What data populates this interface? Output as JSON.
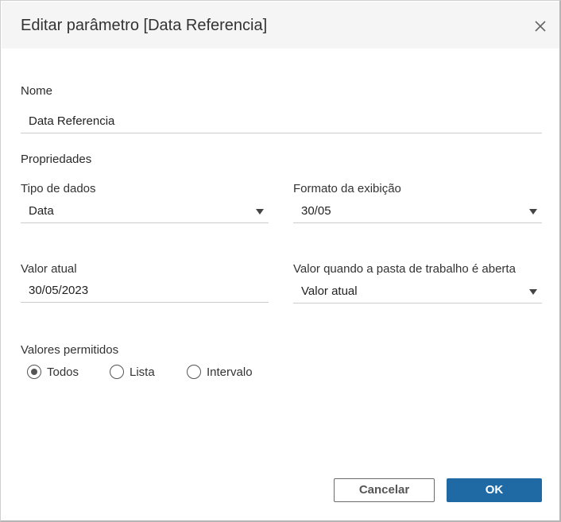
{
  "dialog": {
    "title": "Editar parâmetro [Data Referencia]",
    "close_icon": "close-icon"
  },
  "name_section": {
    "label": "Nome",
    "value": "Data Referencia"
  },
  "properties": {
    "label": "Propriedades",
    "data_type": {
      "label": "Tipo de dados",
      "value": "Data"
    },
    "display_format": {
      "label": "Formato da exibição",
      "value": "30/05"
    },
    "current_value": {
      "label": "Valor atual",
      "value": "30/05/2023"
    },
    "workbook_open_value": {
      "label": "Valor quando a pasta de trabalho é aberta",
      "value": "Valor atual"
    }
  },
  "allowed_values": {
    "label": "Valores permitidos",
    "options": [
      {
        "label": "Todos",
        "selected": true
      },
      {
        "label": "Lista",
        "selected": false
      },
      {
        "label": "Intervalo",
        "selected": false
      }
    ]
  },
  "buttons": {
    "cancel": "Cancelar",
    "ok": "OK"
  },
  "colors": {
    "primary": "#1f6aa5",
    "header_bg": "#f5f5f5",
    "text": "#333333"
  }
}
